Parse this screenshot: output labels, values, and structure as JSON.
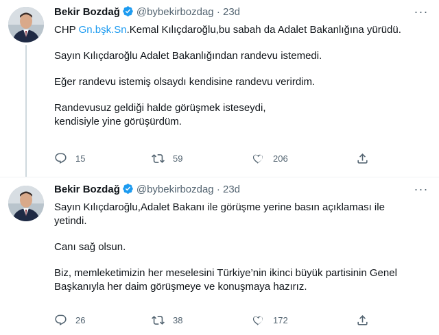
{
  "tweets": [
    {
      "author_name": "Bekir Bozdağ",
      "handle": "@bybekirbozdag",
      "separator": "·",
      "age": "23d",
      "more": "···",
      "line1_prefix": "CHP ",
      "line1_link": "Gn.bşk.Sn",
      "line1_suffix": ".Kemal Kılıçdaroğlu,bu sabah da Adalet Bakanlığına yürüdü.",
      "para2": "Sayın Kılıçdaroğlu Adalet Bakanlığından randevu istemedi.",
      "para3": "Eğer randevu istemiş olsaydı kendisine randevu verirdim.",
      "para4_line1": "Randevusuz geldiği halde görüşmek isteseydi,",
      "para4_line2": "kendisiyle yine görüşürdüm.",
      "replies": "15",
      "retweets": "59",
      "likes": "206"
    },
    {
      "author_name": "Bekir Bozdağ",
      "handle": "@bybekirbozdag",
      "separator": "·",
      "age": "23d",
      "more": "···",
      "para1_line1": "Sayın Kılıçdaroğlu,Adalet Bakanı ile görüşme yerine basın açıklaması ile",
      "para1_line2": "yetindi.",
      "para2": "Canı sağ olsun.",
      "para3_line1": "Biz, memleketimizin her meselesini Türkiye’nin ikinci büyük partisinin Genel",
      "para3_line2": "Başkanıyla her daim görüşmeye ve konuşmaya hazırız.",
      "replies": "26",
      "retweets": "38",
      "likes": "172"
    }
  ],
  "colors": {
    "link": "#1d9bf0",
    "verified": "#1d9bf0",
    "secondary_text": "#536471",
    "thread_line": "#cfd9de"
  },
  "icons": [
    "verified-badge-icon",
    "more-icon",
    "reply-icon",
    "retweet-icon",
    "like-icon",
    "share-icon"
  ]
}
